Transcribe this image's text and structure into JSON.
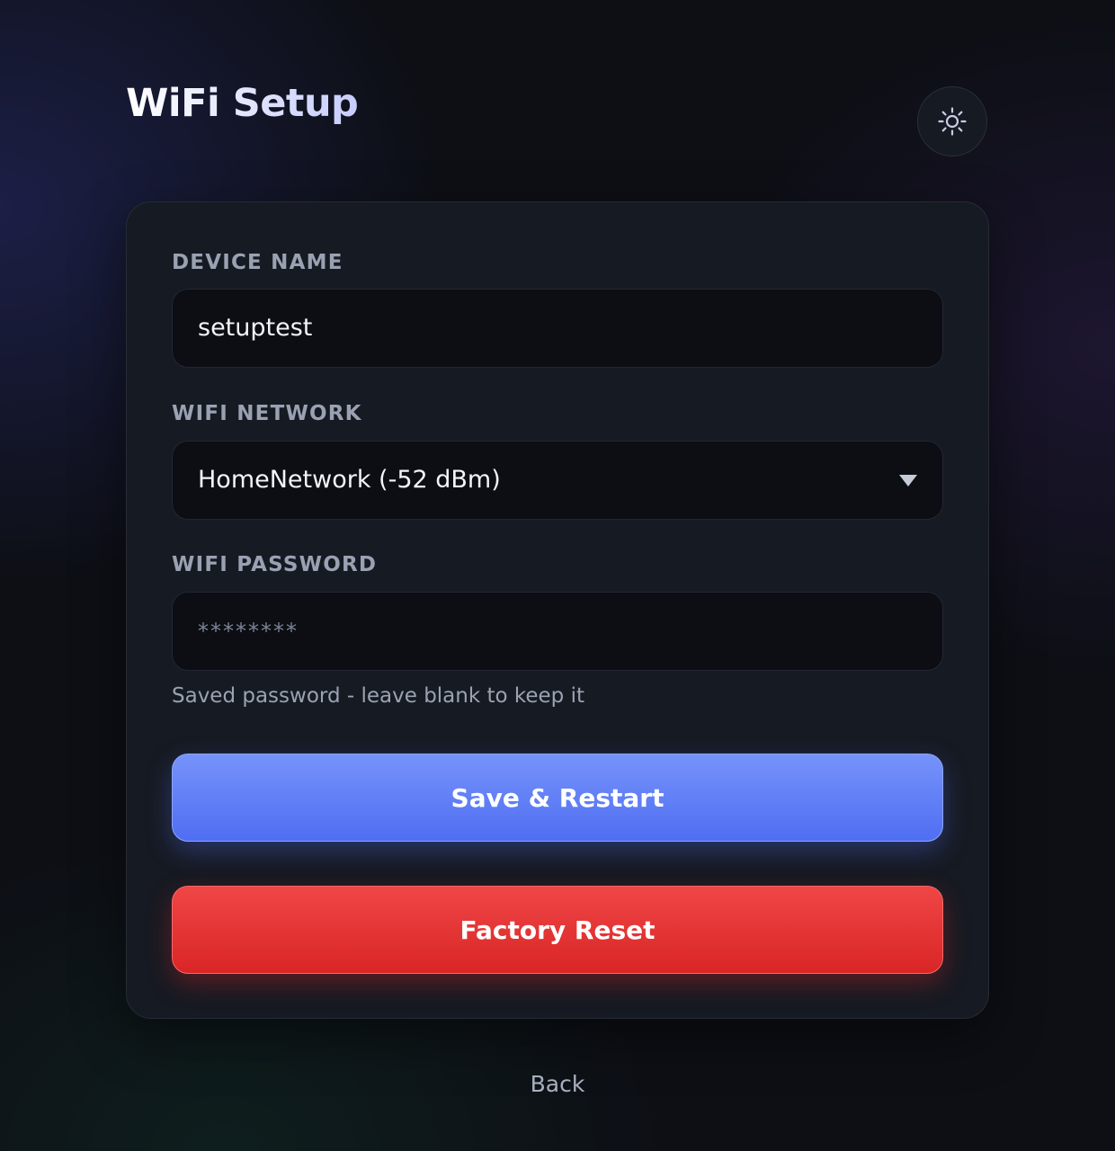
{
  "header": {
    "title": "WiFi Setup",
    "theme_toggle_icon": "sun-icon"
  },
  "form": {
    "device_name": {
      "label": "DEVICE NAME",
      "value": "setuptest"
    },
    "wifi_network": {
      "label": "WIFI NETWORK",
      "selected": "HomeNetwork (-52 dBm)",
      "icon": "chevron-down-icon"
    },
    "wifi_password": {
      "label": "WIFI PASSWORD",
      "placeholder": "********",
      "hint": "Saved password - leave blank to keep it"
    },
    "save_button": "Save & Restart",
    "reset_button": "Factory Reset"
  },
  "footer": {
    "back_link": "Back"
  },
  "colors": {
    "accent": "#5b78f5",
    "danger": "#e23333",
    "background": "#0d0f15",
    "card": "#161a22",
    "input": "#0c0e14"
  }
}
